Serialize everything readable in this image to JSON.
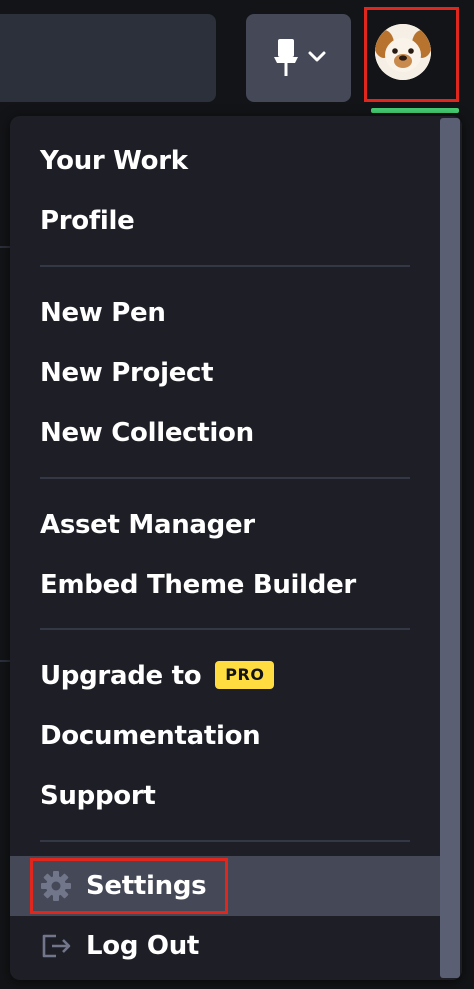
{
  "header": {
    "pin_button": {
      "icon": "pin-icon",
      "caret": "chevron-down-icon"
    },
    "avatar": {
      "icon": "dog-avatar",
      "status_color": "#47cf73"
    }
  },
  "menu": {
    "groups": [
      {
        "items": [
          {
            "label": "Your Work"
          },
          {
            "label": "Profile"
          }
        ]
      },
      {
        "items": [
          {
            "label": "New Pen"
          },
          {
            "label": "New Project"
          },
          {
            "label": "New Collection"
          }
        ]
      },
      {
        "items": [
          {
            "label": "Asset Manager"
          },
          {
            "label": "Embed Theme Builder"
          }
        ]
      },
      {
        "items": [
          {
            "label": "Upgrade to",
            "badge": "PRO"
          },
          {
            "label": "Documentation"
          },
          {
            "label": "Support"
          }
        ]
      }
    ],
    "settings": {
      "label": "Settings",
      "icon": "gear-icon"
    },
    "logout": {
      "label": "Log Out",
      "icon": "logout-icon"
    }
  },
  "colors": {
    "background": "#131417",
    "menu_bg": "#1e1f26",
    "highlight": "#444857",
    "pro_badge": "#ffdd40",
    "annotation_red": "#e0261d"
  }
}
